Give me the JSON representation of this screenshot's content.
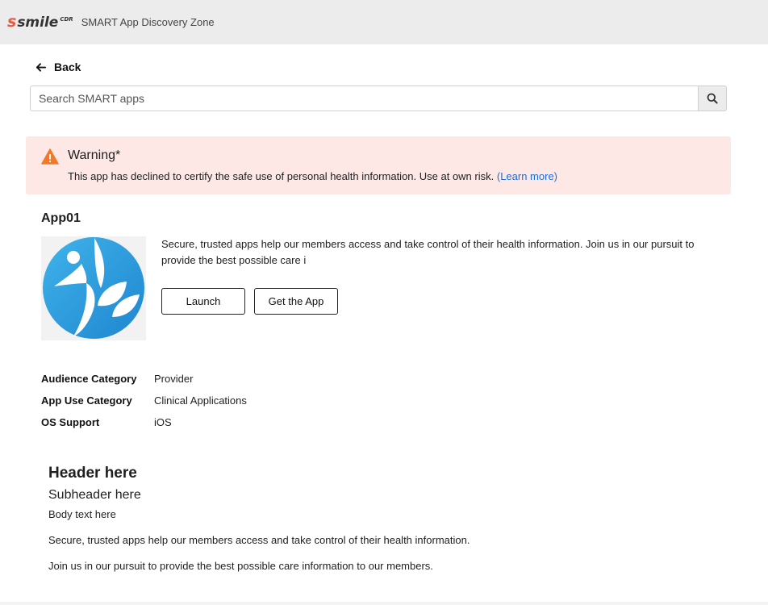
{
  "header": {
    "logo_s": "s",
    "logo_word": "smile",
    "logo_cdr": "CDR",
    "title": "SMART App Discovery Zone"
  },
  "nav": {
    "back_label": "Back",
    "back_icon": "arrow-left-icon"
  },
  "search": {
    "placeholder": "Search SMART apps",
    "value": "",
    "icon": "search-icon"
  },
  "warning": {
    "icon": "warning-triangle-icon",
    "title": "Warning*",
    "message": "This app has declined to certify the safe use of personal health information. Use at own risk.",
    "link_label": "(Learn more)",
    "accent": "#f07a2a",
    "background": "#fde8e6"
  },
  "app": {
    "name": "App01",
    "logo_icon": "person-leaf-logo-icon",
    "description": "Secure, trusted apps help our members access and take control of their health information. Join us in our pursuit to provide the best possible care i",
    "launch_label": "Launch",
    "get_app_label": "Get the App",
    "details": [
      {
        "label": "Audience Category",
        "value": "Provider"
      },
      {
        "label": "App Use Category",
        "value": "Clinical Applications"
      },
      {
        "label": "OS Support",
        "value": "iOS"
      }
    ]
  },
  "content": {
    "header": "Header here",
    "subheader": "Subheader here",
    "body": "Body text here",
    "paragraph1": "Secure, trusted apps help our members access and take control of their health information.",
    "paragraph2": "Join us in our pursuit to provide the best possible care information to our members."
  },
  "colors": {
    "link": "#1b6fd6",
    "logo_blue": "#2a9ee0",
    "brand_red": "#e35a45"
  }
}
